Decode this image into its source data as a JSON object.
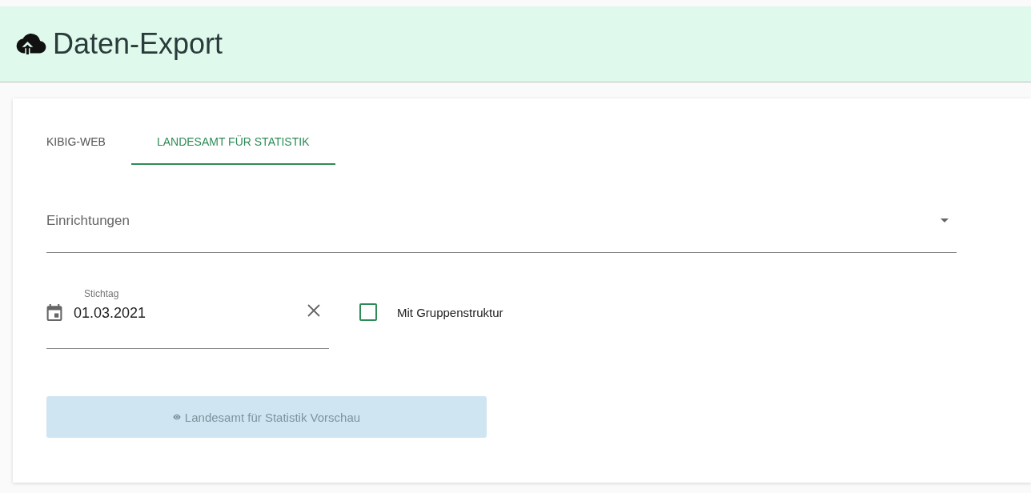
{
  "header": {
    "title": "Daten-Export"
  },
  "tabs": [
    {
      "label": "KIBIG-WEB",
      "selected": false
    },
    {
      "label": "LANDESAMT FÜR STATISTIK",
      "selected": true
    }
  ],
  "facility_select": {
    "placeholder": "Einrichtungen"
  },
  "date_field": {
    "label": "Stichtag",
    "value": "01.03.2021"
  },
  "group_checkbox": {
    "label": "Mit Gruppenstruktur",
    "checked": false
  },
  "preview_button": {
    "label": "Landesamt für Statistik Vorschau",
    "disabled": true
  }
}
